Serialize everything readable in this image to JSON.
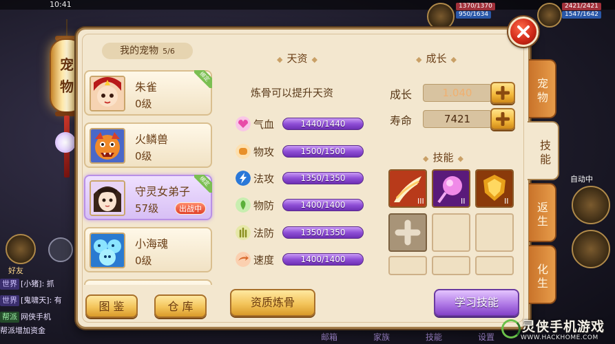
{
  "status_bar": {
    "time": "10:41"
  },
  "top_stats": [
    "1370/1370",
    "950/1634",
    "2421/2421",
    "1547/1642"
  ],
  "lantern": {
    "chars": [
      "宠",
      "物"
    ]
  },
  "pet_list": {
    "title": "我的宠物",
    "count": "5/6",
    "bound_label": "绑定",
    "battle_label": "出战中",
    "pets": [
      {
        "name": "朱雀",
        "level": "0级",
        "bound": true,
        "selected": false,
        "avatar": "zhuque-avatar"
      },
      {
        "name": "火鳞兽",
        "level": "0级",
        "bound": false,
        "selected": false,
        "avatar": "huolinshou-avatar"
      },
      {
        "name": "守灵女弟子",
        "level": "57级",
        "bound": true,
        "selected": true,
        "battle": true,
        "avatar": "shouling-avatar"
      },
      {
        "name": "小海魂",
        "level": "0级",
        "bound": false,
        "selected": false,
        "avatar": "xiaohaihun-avatar"
      }
    ],
    "buttons": {
      "gallery": "图 鉴",
      "storage": "仓 库"
    }
  },
  "talent": {
    "title": "天资",
    "subtitle": "炼骨可以提升天资",
    "attributes": [
      {
        "label": "气血",
        "value": "1440/1440",
        "icon": "heart-icon",
        "color": "#f07ac8"
      },
      {
        "label": "物攻",
        "value": "1500/1500",
        "icon": "fist-icon",
        "color": "#f0a048"
      },
      {
        "label": "法攻",
        "value": "1350/1350",
        "icon": "lightning-icon",
        "color": "#3a8ae8"
      },
      {
        "label": "物防",
        "value": "1400/1400",
        "icon": "leaf-shield-icon",
        "color": "#6ac04a"
      },
      {
        "label": "法防",
        "value": "1350/1350",
        "icon": "magic-shield-icon",
        "color": "#a8b030"
      },
      {
        "label": "速度",
        "value": "1400/1400",
        "icon": "speed-icon",
        "color": "#e07838"
      }
    ],
    "refine_button": "资质炼骨"
  },
  "growth": {
    "title": "成长",
    "growth_label": "成长",
    "growth_value": "1.040",
    "life_label": "寿命",
    "life_value": "7421",
    "skills_title": "技能",
    "learn_button": "学习技能"
  },
  "side_tabs": [
    {
      "label": "宠物",
      "active": false
    },
    {
      "label": "技能",
      "active": true
    },
    {
      "label": "返生",
      "active": false
    },
    {
      "label": "化生",
      "active": false
    }
  ],
  "background": {
    "auto_battle": "自动中",
    "friends": "好友",
    "chat": [
      {
        "tag": "世界",
        "text": "[小猪]: 抓"
      },
      {
        "tag": "世界",
        "text": "[鬼啸天]: 有"
      },
      {
        "tag": "帮派",
        "text": "网侠手机"
      },
      {
        "tag": "",
        "text": "帮派增加资金"
      }
    ],
    "bottom_labels": [
      "邮箱",
      "家族",
      "技能",
      "设置"
    ]
  },
  "watermark": {
    "title": "灵侠手机游戏",
    "url": "WWW.HACKHOME.COM"
  },
  "colors": {
    "panel_bg": "#f3e7cf",
    "accent_purple": "#8f4fd6",
    "accent_gold": "#f3c45a",
    "close_red": "#d02a18"
  }
}
